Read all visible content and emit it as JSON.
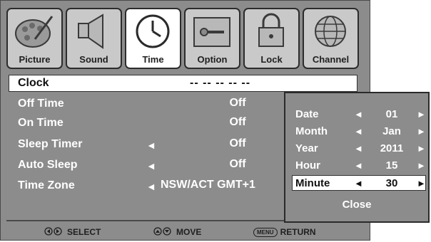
{
  "tabs": [
    {
      "label": "Picture",
      "icon": "palette-icon"
    },
    {
      "label": "Sound",
      "icon": "speaker-icon"
    },
    {
      "label": "Time",
      "icon": "clock-icon",
      "active": true
    },
    {
      "label": "Option",
      "icon": "toolbox-icon"
    },
    {
      "label": "Lock",
      "icon": "padlock-icon"
    },
    {
      "label": "Channel",
      "icon": "globe-icon"
    }
  ],
  "clock": {
    "label": "Clock",
    "value": "-- -- -- -- --"
  },
  "rows": [
    {
      "label": "Off Time",
      "value": "Off"
    },
    {
      "label": "On Time",
      "value": "Off"
    },
    {
      "label": "Sleep Timer",
      "value": "Off",
      "arrow": "◄"
    },
    {
      "label": "Auto Sleep",
      "value": "Off",
      "arrow": "◄"
    },
    {
      "label": "Time Zone",
      "value": "NSW/ACT GMT+1",
      "arrow": "◄"
    }
  ],
  "popup": {
    "rows": [
      {
        "label": "Date",
        "value": "01"
      },
      {
        "label": "Month",
        "value": "Jan"
      },
      {
        "label": "Year",
        "value": "2011"
      },
      {
        "label": "Hour",
        "value": "15"
      },
      {
        "label": "Minute",
        "value": "30",
        "selected": true
      }
    ],
    "left_arrow": "◄",
    "right_arrow": "►",
    "close_label": "Close"
  },
  "help": {
    "select_label": "SELECT",
    "move_label": "MOVE",
    "menu_key": "MENU",
    "return_label": "RETURN"
  },
  "colors": {
    "panel": "#8c8c8c",
    "tab": "#c9c9c9",
    "highlight": "#ffffff",
    "text": "#ffffff"
  }
}
